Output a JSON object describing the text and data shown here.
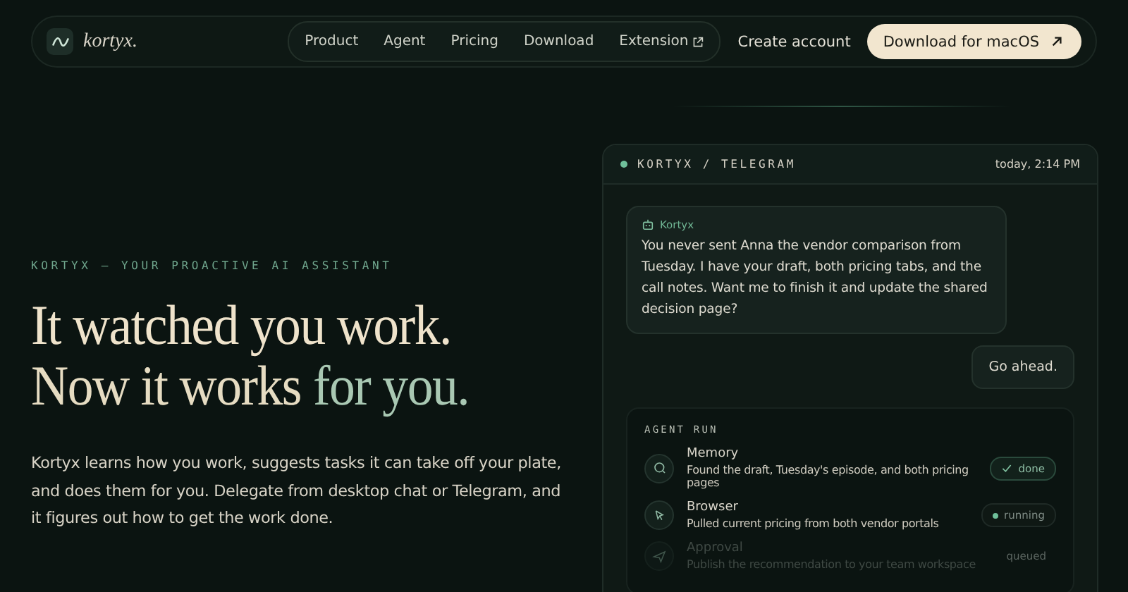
{
  "nav": {
    "brand": "kortyx.",
    "links": [
      {
        "label": "Product",
        "external": false
      },
      {
        "label": "Agent",
        "external": false
      },
      {
        "label": "Pricing",
        "external": false
      },
      {
        "label": "Download",
        "external": false
      },
      {
        "label": "Extension",
        "external": true
      }
    ],
    "account": "Create account",
    "cta": "Download for macOS"
  },
  "hero": {
    "eyebrow": "KORTYX — YOUR PROACTIVE AI ASSISTANT",
    "headline_1": "It watched you work.",
    "headline_2a": "Now it works ",
    "headline_2b": "for you.",
    "body": "Kortyx learns how you work, suggests tasks it can take off your plate, and does them for you. Delegate from desktop chat or Telegram, and it figures out how to get the work done."
  },
  "chat": {
    "title": "KORTYX / TELEGRAM",
    "time": "today, 2:14 PM",
    "messages": [
      {
        "kind": "agent",
        "sender": "Kortyx",
        "text": "You never sent Anna the vendor comparison from Tuesday. I have your draft, both pricing tabs, and the call notes. Want me to finish it and update the shared decision page?"
      },
      {
        "kind": "user",
        "text": "Go ahead."
      }
    ],
    "run": {
      "title": "AGENT RUN",
      "steps": [
        {
          "kind": "memory",
          "name": "Memory",
          "detail": "Found the draft, Tuesday's episode, and both pricing pages",
          "status": "done"
        },
        {
          "kind": "browser",
          "name": "Browser",
          "detail": "Pulled current pricing from both vendor portals",
          "status": "running"
        },
        {
          "kind": "approval",
          "name": "Approval",
          "detail": "Publish the recommendation to your team workspace",
          "status": "queued"
        }
      ]
    }
  }
}
